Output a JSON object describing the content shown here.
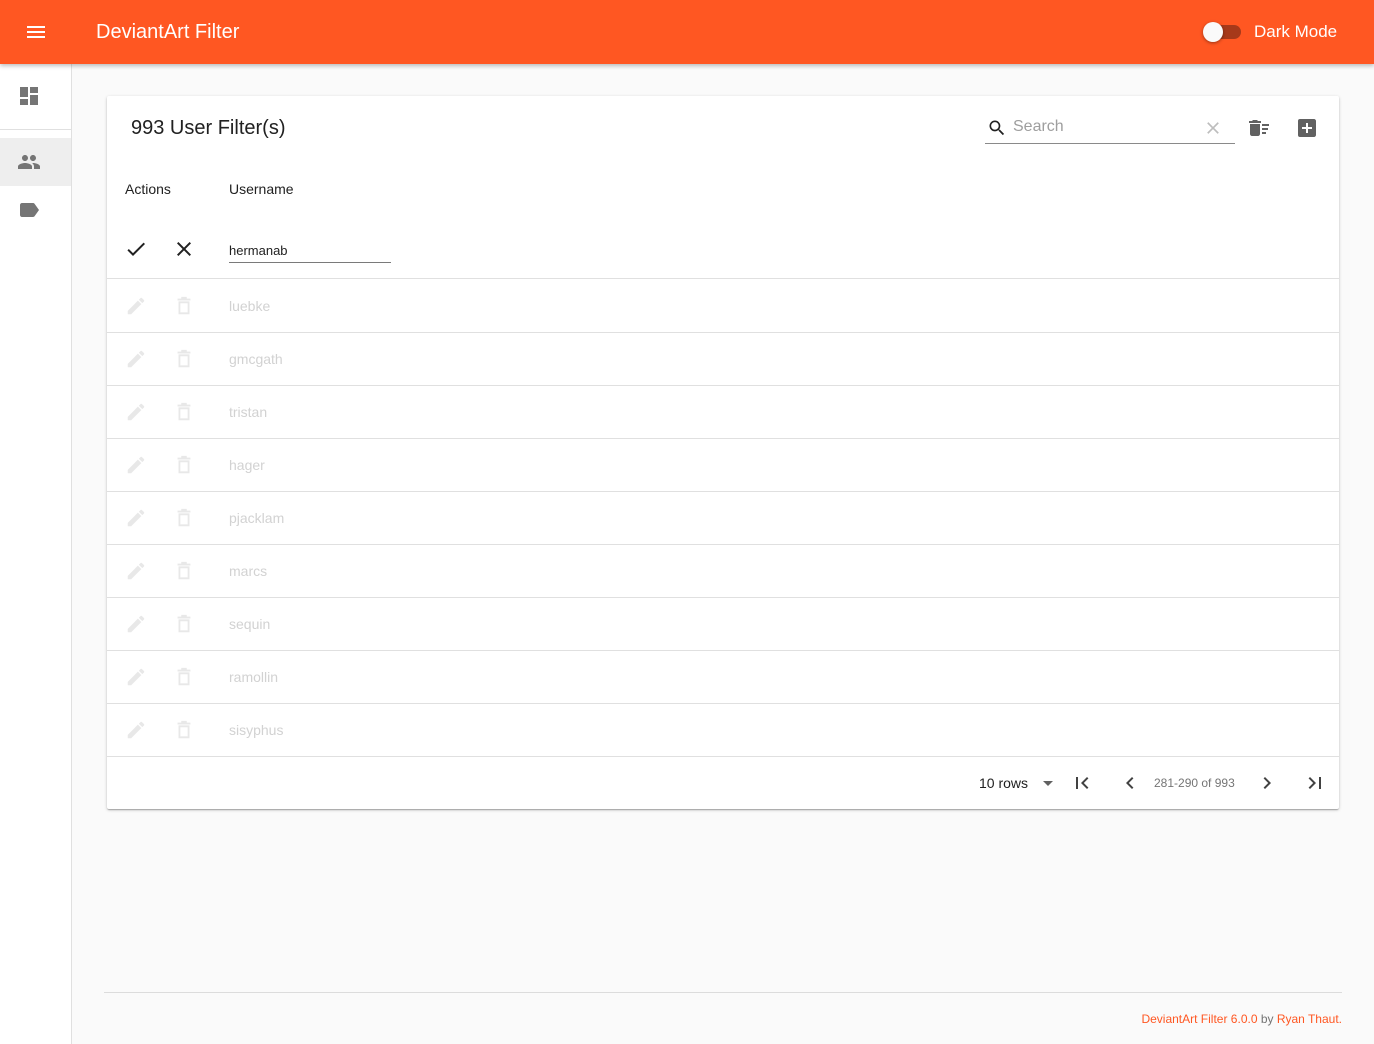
{
  "app": {
    "title": "DeviantArt Filter",
    "dark_mode_label": "Dark Mode",
    "dark_mode_on": false,
    "accent": "#ff5722"
  },
  "nav": {
    "items": [
      {
        "icon": "dashboard-icon"
      },
      {
        "icon": "people-icon",
        "active": true
      },
      {
        "icon": "label-icon"
      }
    ]
  },
  "card": {
    "title": "993 User Filter(s)",
    "search_placeholder": "Search",
    "search_value": "",
    "toolbar_icons": [
      "delete-sweep-icon",
      "add-box-icon"
    ]
  },
  "table": {
    "headers": {
      "actions": "Actions",
      "username": "Username"
    },
    "editing_value": "hermanab",
    "rows": [
      "luebke",
      "gmcgath",
      "tristan",
      "hager",
      "pjacklam",
      "marcs",
      "sequin",
      "ramollin",
      "sisyphus"
    ]
  },
  "pagination": {
    "rows_label": "10 rows",
    "range": "281-290 of 993"
  },
  "footer": {
    "app_version": "DeviantArt Filter 6.0.0",
    "by": " by ",
    "author": "Ryan Thaut."
  }
}
